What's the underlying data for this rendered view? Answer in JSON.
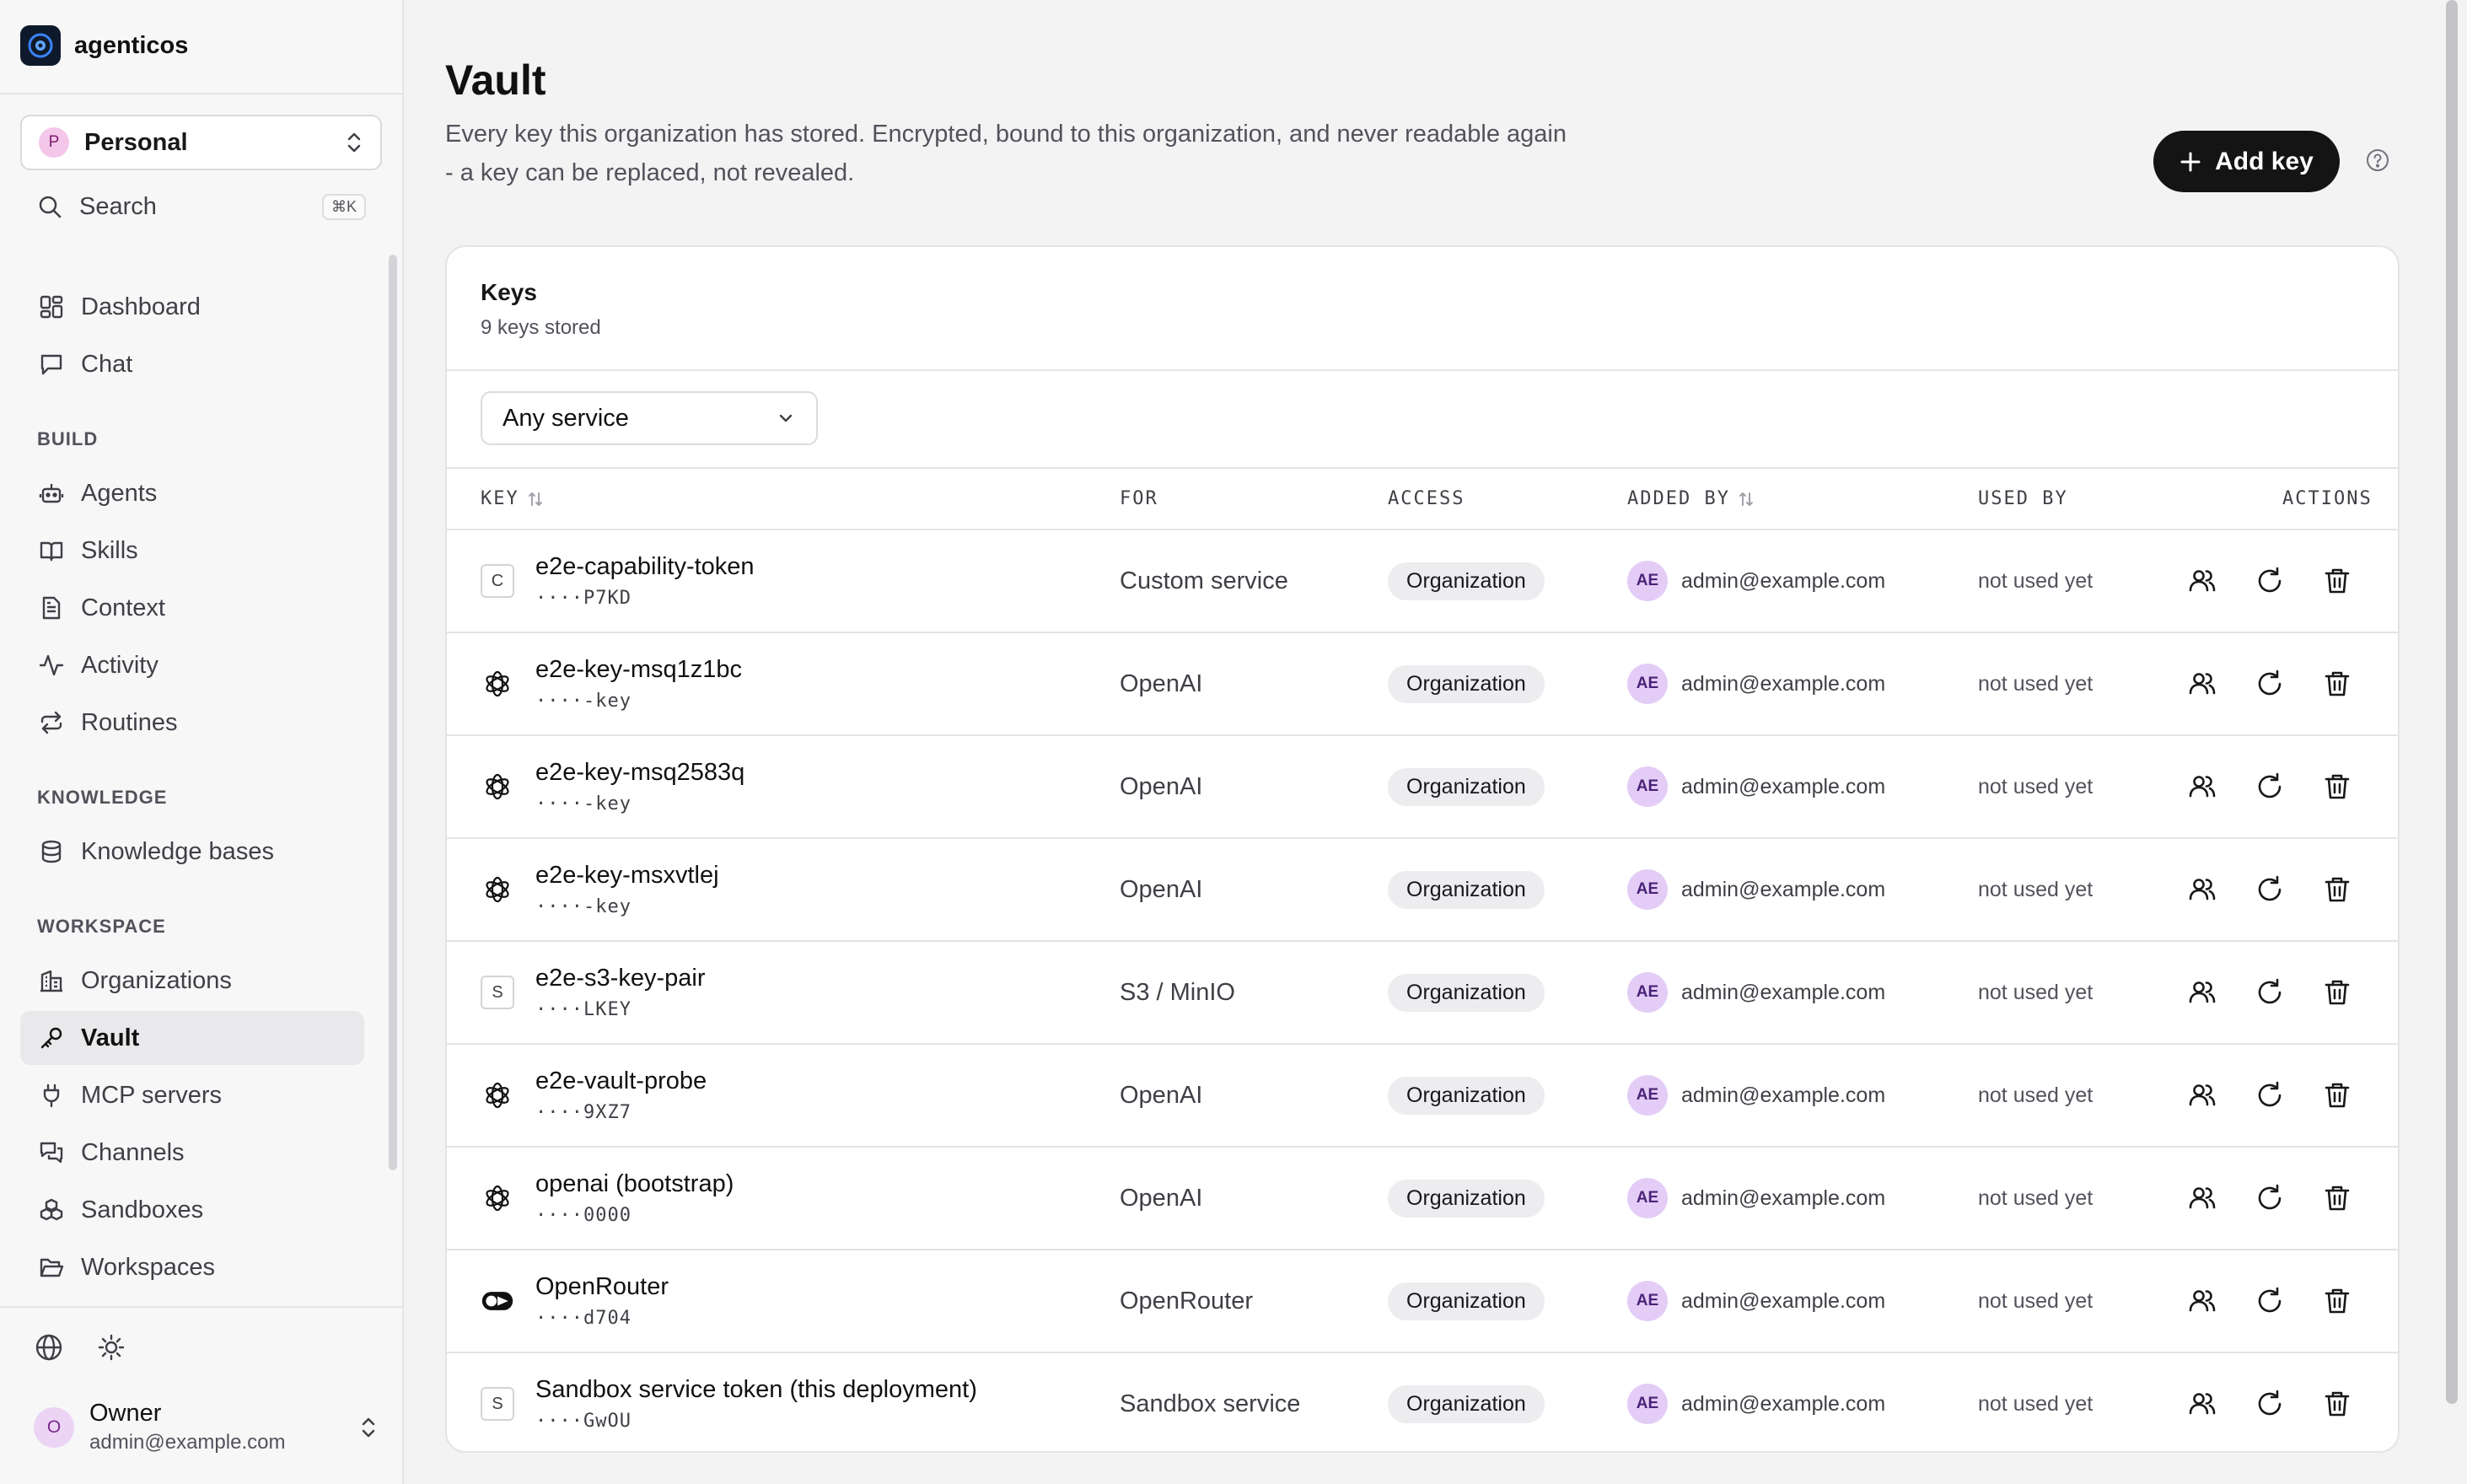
{
  "brand": {
    "name": "agenticos"
  },
  "org": {
    "avatar": "P",
    "name": "Personal"
  },
  "search": {
    "label": "Search",
    "shortcut": "⌘K"
  },
  "nav": {
    "dashboard": "Dashboard",
    "chat": "Chat",
    "build_label": "BUILD",
    "agents": "Agents",
    "skills": "Skills",
    "context": "Context",
    "activity": "Activity",
    "routines": "Routines",
    "knowledge_label": "KNOWLEDGE",
    "knowledge_bases": "Knowledge bases",
    "workspace_label": "WORKSPACE",
    "organizations": "Organizations",
    "vault": "Vault",
    "mcp_servers": "MCP servers",
    "channels": "Channels",
    "sandboxes": "Sandboxes",
    "workspaces": "Workspaces"
  },
  "user": {
    "avatar": "O",
    "name": "Owner",
    "email": "admin@example.com"
  },
  "page": {
    "title": "Vault",
    "description": "Every key this organization has stored. Encrypted, bound to this organization, and never readable again - a key can be replaced, not revealed.",
    "add_button": "Add key"
  },
  "card": {
    "title": "Keys",
    "subtitle": "9 keys stored"
  },
  "filter": {
    "value": "Any service"
  },
  "columns": {
    "key": "KEY",
    "for": "FOR",
    "access": "ACCESS",
    "added_by": "ADDED BY",
    "used_by": "USED BY",
    "actions": "ACTIONS"
  },
  "rows": [
    {
      "icon": "letter",
      "letter": "C",
      "name": "e2e-capability-token",
      "mask": "····P7KD",
      "for": "Custom service",
      "access": "Organization",
      "avatar": "AE",
      "added_by": "admin@example.com",
      "used_by": "not used yet"
    },
    {
      "icon": "openai",
      "letter": "",
      "name": "e2e-key-msq1z1bc",
      "mask": "····-key",
      "for": "OpenAI",
      "access": "Organization",
      "avatar": "AE",
      "added_by": "admin@example.com",
      "used_by": "not used yet"
    },
    {
      "icon": "openai",
      "letter": "",
      "name": "e2e-key-msq2583q",
      "mask": "····-key",
      "for": "OpenAI",
      "access": "Organization",
      "avatar": "AE",
      "added_by": "admin@example.com",
      "used_by": "not used yet"
    },
    {
      "icon": "openai",
      "letter": "",
      "name": "e2e-key-msxvtlej",
      "mask": "····-key",
      "for": "OpenAI",
      "access": "Organization",
      "avatar": "AE",
      "added_by": "admin@example.com",
      "used_by": "not used yet"
    },
    {
      "icon": "letter",
      "letter": "S",
      "name": "e2e-s3-key-pair",
      "mask": "····LKEY",
      "for": "S3 / MinIO",
      "access": "Organization",
      "avatar": "AE",
      "added_by": "admin@example.com",
      "used_by": "not used yet"
    },
    {
      "icon": "openai",
      "letter": "",
      "name": "e2e-vault-probe",
      "mask": "····9XZ7",
      "for": "OpenAI",
      "access": "Organization",
      "avatar": "AE",
      "added_by": "admin@example.com",
      "used_by": "not used yet"
    },
    {
      "icon": "openai",
      "letter": "",
      "name": "openai (bootstrap)",
      "mask": "····0000",
      "for": "OpenAI",
      "access": "Organization",
      "avatar": "AE",
      "added_by": "admin@example.com",
      "used_by": "not used yet"
    },
    {
      "icon": "openrouter",
      "letter": "",
      "name": "OpenRouter",
      "mask": "····d704",
      "for": "OpenRouter",
      "access": "Organization",
      "avatar": "AE",
      "added_by": "admin@example.com",
      "used_by": "not used yet"
    },
    {
      "icon": "letter",
      "letter": "S",
      "name": "Sandbox service token (this deployment)",
      "mask": "····GwOU",
      "for": "Sandbox service",
      "access": "Organization",
      "avatar": "AE",
      "added_by": "admin@example.com",
      "used_by": "not used yet"
    }
  ]
}
